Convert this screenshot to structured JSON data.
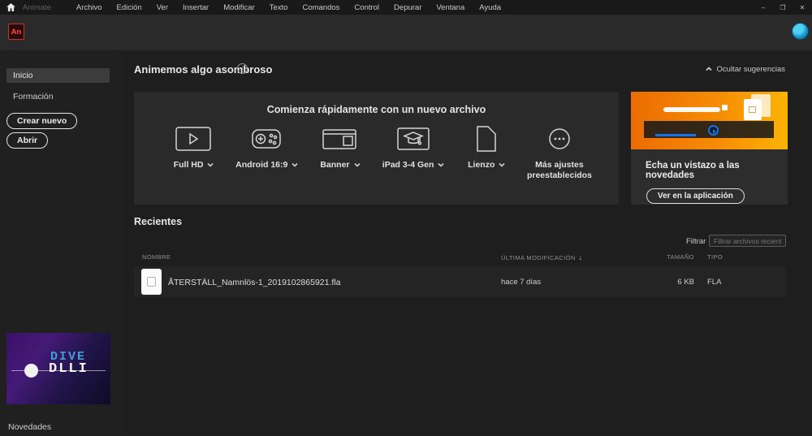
{
  "titlebar": {
    "app_label": "Animate",
    "menu_items": [
      "Archivo",
      "Edición",
      "Ver",
      "Insertar",
      "Modificar",
      "Texto",
      "Comandos",
      "Control",
      "Depurar",
      "Ventana",
      "Ayuda"
    ],
    "window": {
      "minimize": "–",
      "restore": "❐",
      "close": "✕"
    }
  },
  "appbar": {
    "logo_text": "An"
  },
  "sidebar": {
    "items": [
      {
        "label": "Inicio"
      },
      {
        "label": "Formación"
      }
    ],
    "create_button_label": "Crear nuevo",
    "open_button_label": "Abrir",
    "promo": {
      "line1": "DIVE",
      "line2": "DLLI"
    },
    "novedades_label": "Novedades"
  },
  "main": {
    "title": "Animemos algo asombroso",
    "info_glyph": "i",
    "hide_suggestions_label": "Ocultar sugerencias",
    "quickstart": {
      "title": "Comienza rápidamente con un nuevo archivo",
      "presets": [
        {
          "label": "Full HD",
          "icon": "video-play-icon",
          "has_chevron": true
        },
        {
          "label": "Android 16:9",
          "icon": "gamepad-icon",
          "has_chevron": true
        },
        {
          "label": "Banner",
          "icon": "browser-banner-icon",
          "has_chevron": true
        },
        {
          "label": "iPad 3-4 Gen",
          "icon": "education-tablet-icon",
          "has_chevron": true
        },
        {
          "label": "Lienzo",
          "icon": "document-icon",
          "has_chevron": true
        },
        {
          "label": "Más ajustes preestablecidos",
          "icon": "more-presets-icon",
          "has_chevron": false
        }
      ]
    },
    "whatsnew": {
      "title": "Echa un vistazo a las novedades",
      "button_label": "Ver en la aplicación"
    },
    "recents": {
      "title": "Recientes",
      "filter_label": "Filtrar",
      "filter_placeholder": "Filtrar archivos recientes",
      "columns": [
        "NOMBRE",
        "ÚLTIMA MODIFICACIÓN",
        "TAMAÑO",
        "TIPO"
      ],
      "sort_glyph": "↓",
      "rows": [
        {
          "name": "ÅTERSTÄLL_Namnlös-1_2019102865921.fla",
          "modified": "hace 7 días",
          "size": "6 KB",
          "type": "FLA"
        }
      ]
    }
  },
  "colors": {
    "accent_blue": "#1473e6",
    "promo_orange_start": "#ec6c02",
    "promo_orange_end": "#fbb303",
    "logo_red": "#ff4b3e",
    "promo_text_blue": "#3e9fd6"
  }
}
